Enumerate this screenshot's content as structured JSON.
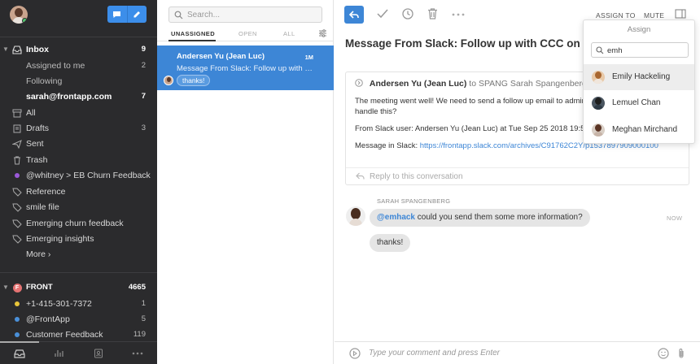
{
  "sidebar": {
    "items": [
      {
        "label": "Inbox",
        "count": "9"
      },
      {
        "label": "Assigned to me",
        "count": "2"
      },
      {
        "label": "Following",
        "count": ""
      },
      {
        "label": "sarah@frontapp.com",
        "count": "7"
      },
      {
        "label": "All",
        "count": ""
      },
      {
        "label": "Drafts",
        "count": "3"
      },
      {
        "label": "Sent",
        "count": ""
      },
      {
        "label": "Trash",
        "count": ""
      },
      {
        "label": "@whitney > EB Churn Feedback",
        "count": ""
      },
      {
        "label": "Reference",
        "count": ""
      },
      {
        "label": "smile file",
        "count": ""
      },
      {
        "label": "Emerging churn feedback",
        "count": ""
      },
      {
        "label": "Emerging insights",
        "count": ""
      },
      {
        "label": "More ›",
        "count": ""
      }
    ],
    "team": {
      "label": "FRONT",
      "badge": "F",
      "count": "4665",
      "items": [
        {
          "label": "+1-415-301-7372",
          "count": "1",
          "color": "#e8c53a"
        },
        {
          "label": "@FrontApp",
          "count": "5",
          "color": "#4a90d9"
        },
        {
          "label": "Customer Feedback",
          "count": "119",
          "color": "#4a90d9"
        }
      ]
    },
    "accent_dot_color": "#9b59d9"
  },
  "list": {
    "search_placeholder": "Search...",
    "tabs": [
      "UNASSIGNED",
      "OPEN",
      "ALL"
    ],
    "conversation": {
      "from": "Andersen Yu (Jean Luc)",
      "time": "1M",
      "subject": "Message From Slack: Follow up with C...",
      "comment": "thanks!"
    }
  },
  "main": {
    "toolbar": {
      "assign_to": "ASSIGN TO",
      "mute": "MUTE"
    },
    "subject": "Message From Slack: Follow up with CCC on Ana",
    "message": {
      "sender": "Andersen Yu (Jean Luc)",
      "to": "to SPANG Sarah Spangenberg (s",
      "line1": "The meeting went well! We need to send a follow up email to admins a",
      "line2": "handle this?",
      "line3": "From Slack user: Andersen Yu (Jean Luc) at Tue Sep 25 2018 19:51:4",
      "line4_prefix": "Message in Slack: ",
      "line4_link": "https://frontapp.slack.com/archives/C91762C2Y/p1537897909000100",
      "reply": "Reply to this conversation"
    },
    "comments": {
      "author": "SARAH SPANGENBERG",
      "mention": "@emhack",
      "text1": " could you send them some more information?",
      "text2": "thanks!",
      "time": "NOW"
    },
    "composer_placeholder": "Type your comment and press Enter"
  },
  "assign": {
    "title": "Assign",
    "query": "emh",
    "options": [
      "Emily Hackeling",
      "Lemuel Chan",
      "Meghan Mirchand"
    ]
  },
  "colors": {
    "accent": "#3d86d6",
    "sidebar_bg": "#2b2b2d"
  }
}
